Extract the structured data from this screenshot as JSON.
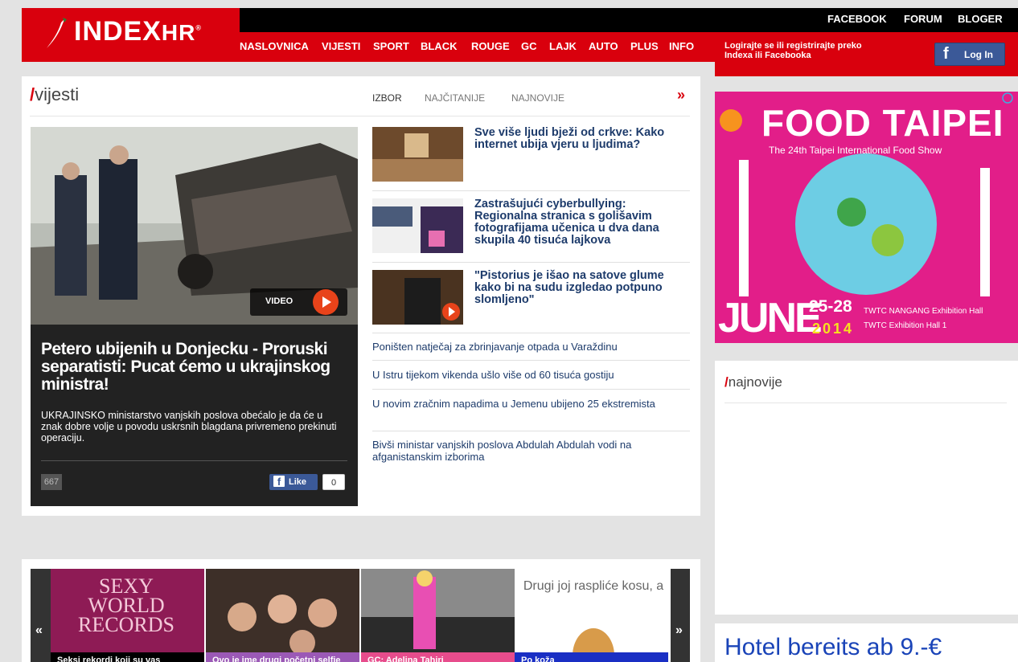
{
  "header": {
    "logo_text": "INDEX",
    "logo_suffix": "HR",
    "top_links": [
      "FACEBOOK",
      "FORUM",
      "BLOGER"
    ],
    "nav": [
      "NASLOVNICA",
      "VIJESTI",
      "SPORT",
      "BLACK",
      "ROUGE",
      "GC",
      "LAJK",
      "AUTO",
      "PLUS",
      "INFO"
    ],
    "login_text": "Logirajte se ili registrirajte preko Indexa ili Facebooka",
    "login_button": "Log In",
    "brand_color": "#d9000d"
  },
  "vijesti": {
    "title": "vijesti",
    "tabs": [
      "IZBOR",
      "NAJČITANIJE",
      "NAJNOVIJE"
    ],
    "more": "»",
    "main_story": {
      "title": "Petero ubijenih u Donjecku - Proruski separatisti: Pucat ćemo u ukrajinskog ministra!",
      "description": "UKRAJINSKO ministarstvo vanjskih poslova obećalo je da će u znak dobre volje u povodu uskrsnih blagdana privremeno prekinuti operaciju.",
      "video_label": "VIDEO",
      "comments": "667",
      "like_label": "Like",
      "like_count": "0"
    },
    "side_stories": [
      {
        "title": "Sve više ljudi bježi od crkve: Kako internet ubija vjeru u ljudima?"
      },
      {
        "title": "Zastrašujući cyberbullying: Regionalna stranica s golišavim fotografijama učenica u dva dana skupila 40 tisuća lajkova"
      },
      {
        "title": "\"Pistorius je išao na satove glume kako bi na sudu izgledao potpuno slomljeno\""
      }
    ],
    "links": [
      "Poništen natječaj za zbrinjavanje otpada u Varaždinu",
      "U Istru tijekom vikenda ušlo više od 60 tisuća gostiju",
      "U novim zračnim napadima u Jemenu ubijeno 25 ekstremista",
      "Bivši ministar vanjskih poslova Abdulah Abdulah vodi na afganistanskim izborima"
    ]
  },
  "ad": {
    "headline": "FOOD TAIPEI",
    "subline": "The 24th Taipei International Food Show",
    "month": "JUNE",
    "dates": "25-28",
    "year": "2014",
    "venue1": "TWTC NANGANG Exhibition Hall",
    "venue2": "TWTC Exhibition Hall 1"
  },
  "najnovije": {
    "title": "najnovije"
  },
  "gallery": {
    "prev": "«",
    "next": "»",
    "items": [
      {
        "caption": "Seksi rekordi koji su vas",
        "overlay": "SEXY WORLD RECORDS",
        "color": "#b01a6a"
      },
      {
        "caption": "Ovo je ime drugi početni selfie",
        "overlay": "",
        "color": "#9b59b6"
      },
      {
        "caption": "GC: Adelina Tahiri",
        "overlay": "",
        "color": "#e74c8c"
      },
      {
        "caption": "Po koža",
        "overlay": "Drugi joj raspliće kosu, a",
        "color": "#1a2fc4"
      }
    ]
  },
  "hotel_ad": {
    "text": "Hotel bereits ab 9.-€"
  }
}
